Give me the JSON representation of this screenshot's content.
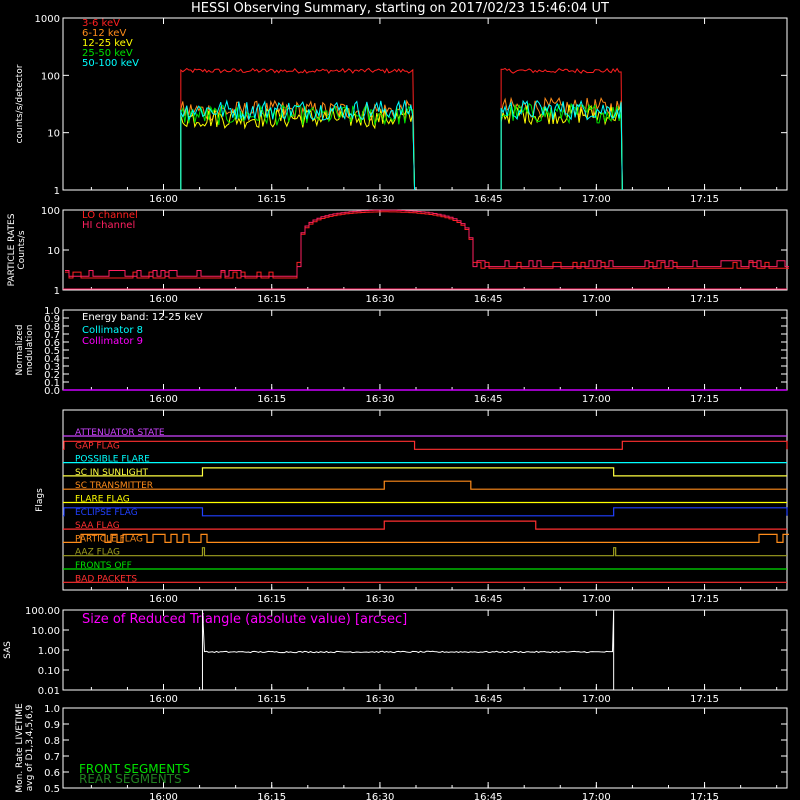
{
  "title": "HESSI Observing Summary, starting on 2017/02/23 15:46:04 UT",
  "time_ticks": [
    "16:00",
    "16:15",
    "16:30",
    "16:45",
    "17:00",
    "17:15"
  ],
  "chart_data": [
    {
      "type": "line",
      "name": "count-rates",
      "ylabel": "counts/s/detector",
      "yscale": "log",
      "ylim": [
        1,
        1000
      ],
      "yticks": [
        "1",
        "10",
        "100",
        "1000"
      ],
      "series": [
        {
          "name": "3-6 keV",
          "color": "#ff2020",
          "segments": [
            [
              16.04,
              16.58,
              120
            ],
            [
              16.78,
              17.06,
              120
            ]
          ]
        },
        {
          "name": "6-12 keV",
          "color": "#ff8c1a",
          "segments": [
            [
              16.04,
              16.58,
              24
            ],
            [
              16.78,
              17.06,
              27
            ]
          ]
        },
        {
          "name": "12-25 keV",
          "color": "#ffff00",
          "segments": [
            [
              16.04,
              16.58,
              18
            ],
            [
              16.78,
              17.06,
              21
            ]
          ]
        },
        {
          "name": "25-50 keV",
          "color": "#00e000",
          "segments": [
            [
              16.04,
              16.58,
              20
            ],
            [
              16.78,
              17.06,
              22
            ]
          ]
        },
        {
          "name": "50-100 keV",
          "color": "#00ffff",
          "segments": [
            [
              16.04,
              16.58,
              25
            ],
            [
              16.78,
              17.06,
              25
            ]
          ]
        }
      ]
    },
    {
      "type": "line",
      "name": "particle-rates",
      "ylabel": "PARTICLE RATES Counts/s",
      "yscale": "log",
      "ylim": [
        1,
        100
      ],
      "yticks": [
        "1",
        "10",
        "100"
      ],
      "series": [
        {
          "name": "LO channel",
          "color": "#ff2020"
        },
        {
          "name": "HI channel",
          "color": "#ff2060"
        }
      ],
      "peak_time": "16:30",
      "peak_value": 90
    },
    {
      "type": "line",
      "name": "modulation",
      "ylabel": "Normalized modulation",
      "ylim": [
        0.0,
        1.0
      ],
      "yticks": [
        "0.0",
        "0.1",
        "0.2",
        "0.3",
        "0.4",
        "0.5",
        "0.6",
        "0.7",
        "0.8",
        "0.9",
        "1.0"
      ],
      "annotation": "Energy band: 12-25 keV",
      "series": [
        {
          "name": "Collimator 8",
          "color": "#00ffff"
        },
        {
          "name": "Collimator 9",
          "color": "#ff00ff"
        }
      ]
    },
    {
      "type": "line",
      "name": "flags",
      "ylabel": "Flags",
      "flags": [
        {
          "name": "ATTENUATOR STATE",
          "color": "#cc44ff",
          "high": []
        },
        {
          "name": "GAP FLAG",
          "color": "#ff3030",
          "high": [
            [
              15.77,
              16.58
            ],
            [
              17.06,
              17.52
            ]
          ]
        },
        {
          "name": "POSSIBLE FLARE",
          "color": "#00ffff",
          "high": []
        },
        {
          "name": "SC IN SUNLIGHT",
          "color": "#ffff40",
          "high": [
            [
              16.09,
              17.04
            ]
          ]
        },
        {
          "name": "SC TRANSMITTER",
          "color": "#ff8c1a",
          "high": [
            [
              16.51,
              16.71
            ]
          ]
        },
        {
          "name": "FLARE FLAG",
          "color": "#ffff00",
          "high": []
        },
        {
          "name": "ECLIPSE FLAG",
          "color": "#2040ff",
          "high": [
            [
              15.77,
              16.09
            ],
            [
              17.04,
              17.52
            ]
          ]
        },
        {
          "name": "SAA FLAG",
          "color": "#ff3030",
          "high": [
            [
              16.51,
              16.86
            ]
          ]
        },
        {
          "name": "PARTICLE FLAG",
          "color": "#ff8c1a",
          "high": []
        },
        {
          "name": "AAZ FLAG",
          "color": "#a0a020",
          "high": []
        },
        {
          "name": "FRONTS OFF",
          "color": "#00e000",
          "high": []
        },
        {
          "name": "BAD PACKETS",
          "color": "#ff3030",
          "high": []
        }
      ]
    },
    {
      "type": "line",
      "name": "sas",
      "ylabel": "SAS",
      "yscale": "log",
      "ylim": [
        0.01,
        100
      ],
      "yticks": [
        "0.01",
        "0.10",
        "1.00",
        "10.00",
        "100.00"
      ],
      "annotation": "Size of Reduced Triangle (absolute value) [arcsec]",
      "annotation_color": "#ff00ff",
      "series": [
        {
          "name": "triangle",
          "color": "#ffffff",
          "segments": [
            [
              16.09,
              17.04,
              0.8
            ]
          ]
        }
      ]
    },
    {
      "type": "line",
      "name": "livetime",
      "ylabel": "Mon. Rate LIVETIME avg of D1,3,4,5,6,9",
      "ylim": [
        0.5,
        1.0
      ],
      "yticks": [
        "0.5",
        "0.6",
        "0.7",
        "0.8",
        "0.9",
        "1.0"
      ],
      "series": [
        {
          "name": "FRONT SEGMENTS",
          "color": "#00e000"
        },
        {
          "name": "REAR SEGMENTS",
          "color": "#208020"
        }
      ]
    }
  ]
}
